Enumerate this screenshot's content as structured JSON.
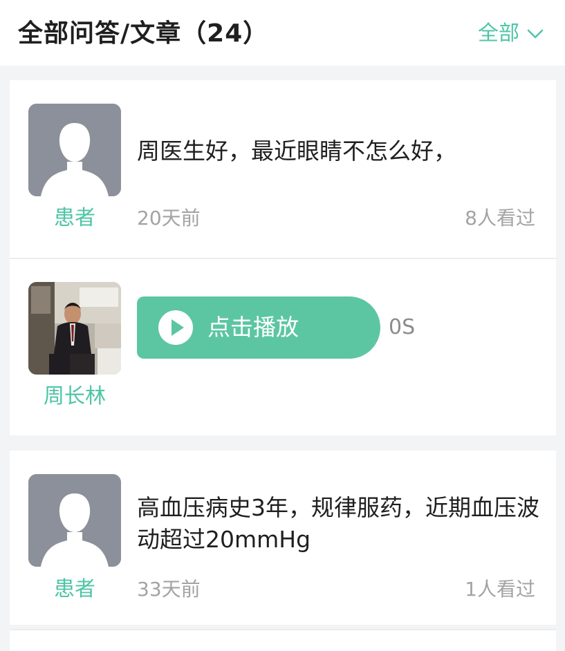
{
  "header": {
    "title": "全部问答/文章（24）",
    "filter_label": "全部",
    "filter_icon": "chevron-down-icon"
  },
  "colors": {
    "accent": "#4ec5a6",
    "play_button": "#5cc6a2",
    "avatar_placeholder": "#8b909a",
    "background": "#f3f4f6"
  },
  "items": [
    {
      "role": "患者",
      "avatar": "person-silhouette-icon",
      "text": "周医生好，最近眼睛不怎么好，",
      "time": "20天前",
      "views": "8人看过"
    },
    {
      "role": "周长林",
      "avatar": "doctor-photo",
      "audio_label": "点击播放",
      "audio_icon": "play-icon",
      "duration": "0S"
    },
    {
      "role": "患者",
      "avatar": "person-silhouette-icon",
      "text": "高血压病史3年，规律服药，近期血压波动超过20mmHg",
      "time": "33天前",
      "views": "1人看过"
    }
  ]
}
